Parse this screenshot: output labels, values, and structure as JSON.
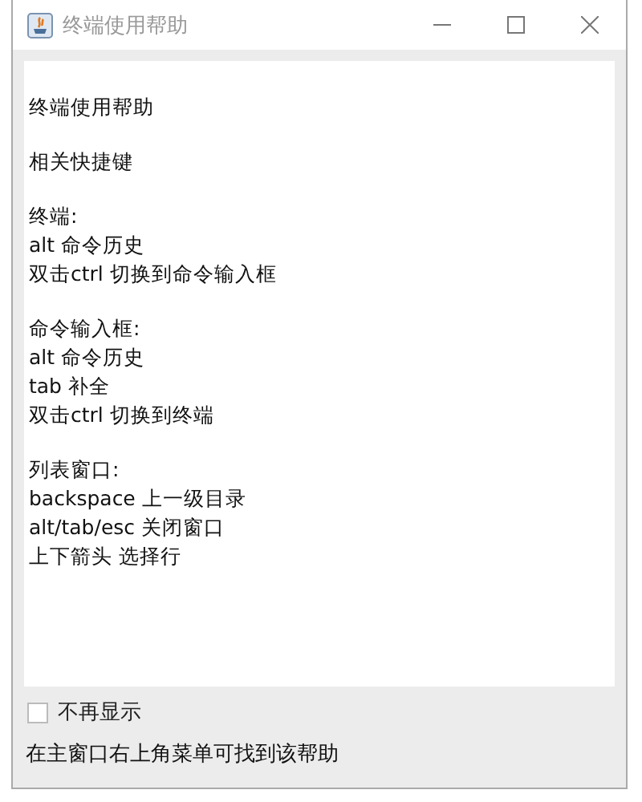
{
  "window": {
    "title": "终端使用帮助"
  },
  "content": {
    "paragraphs": [
      {
        "lines": [
          "终端使用帮助"
        ]
      },
      {
        "lines": [
          "相关快捷键"
        ]
      },
      {
        "lines": [
          "终端:",
          "alt 命令历史",
          "双击ctrl 切换到命令输入框"
        ]
      },
      {
        "lines": [
          "命令输入框:",
          "alt 命令历史",
          "tab 补全",
          "双击ctrl 切换到终端"
        ]
      },
      {
        "lines": [
          "列表窗口:",
          "backspace 上一级目录",
          "alt/tab/esc 关闭窗口",
          "上下箭头 选择行"
        ]
      }
    ]
  },
  "dont_show_again": {
    "label": "不再显示",
    "checked": false
  },
  "footer_note": "在主窗口右上角菜单可找到该帮助"
}
